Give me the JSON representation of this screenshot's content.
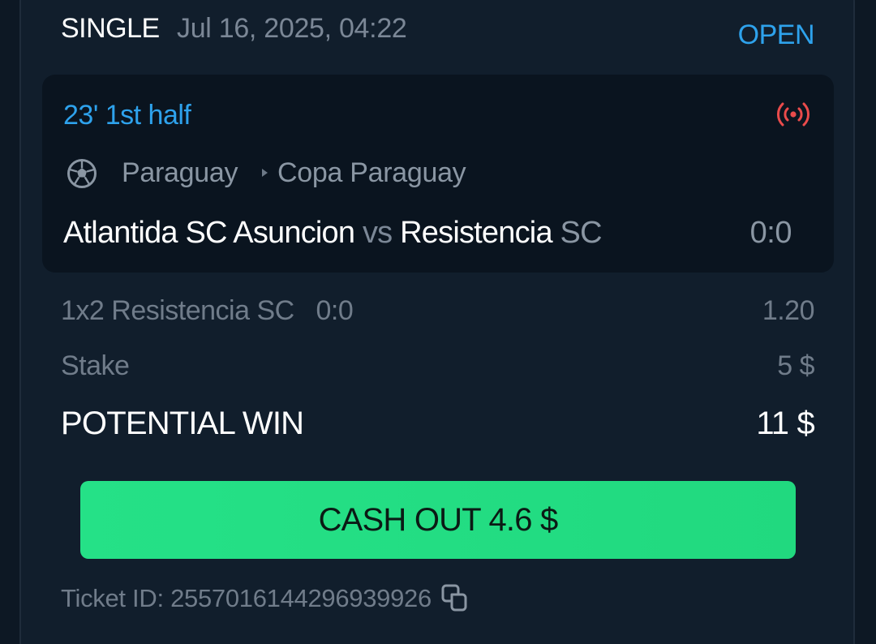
{
  "bet": {
    "type": "SINGLE",
    "date": "Jul 16, 2025, 04:22",
    "status": "OPEN"
  },
  "event": {
    "live_time": "23' 1st half",
    "live_icon": "broadcast-icon",
    "sport_icon": "soccer-ball-icon",
    "country": "Paraguay",
    "league": "Copa Paraguay",
    "home_team": "Atlantida SC Asuncion",
    "vs": "vs",
    "away_team": "Resistencia",
    "away_team_suffix": "SC",
    "score": "0:0"
  },
  "selection": {
    "market": "1x2 Resistencia SC   0:0",
    "odds": "1.20"
  },
  "stake": {
    "label": "Stake",
    "value": "5 $"
  },
  "potential_win": {
    "label": "POTENTIAL WIN",
    "value": "11 $"
  },
  "cashout": {
    "label": "CASH OUT 4.6 $"
  },
  "ticket": {
    "label": "Ticket ID: 2557016144296939926",
    "copy_icon": "copy-icon"
  },
  "colors": {
    "accent_blue": "#2ea2ec",
    "live_red": "#ea4b4b",
    "cashout_green": "#24de84",
    "background": "#0d1824",
    "card": "#111e2c"
  }
}
